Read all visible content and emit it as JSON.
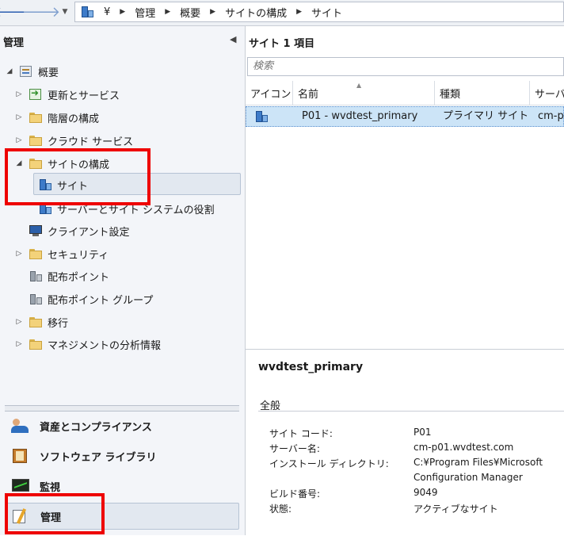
{
  "nav": {
    "back_icon": "back-arrow-icon",
    "forward_icon": "forward-arrow-icon",
    "crumbs": [
      "¥",
      "管理",
      "概要",
      "サイトの構成",
      "サイト"
    ]
  },
  "left_pane": {
    "title": "管理",
    "tree": [
      {
        "label": "概要",
        "icon": "overview-icon",
        "expander": "expanded"
      },
      {
        "label": "更新とサービス",
        "icon": "update-icon",
        "expander": "collapsed"
      },
      {
        "label": "階層の構成",
        "icon": "folder-icon",
        "expander": "collapsed"
      },
      {
        "label": "クラウド サービス",
        "icon": "folder-icon",
        "expander": "collapsed"
      },
      {
        "label": "サイトの構成",
        "icon": "folder-icon",
        "expander": "expanded"
      },
      {
        "label": "サイト",
        "icon": "site-server-icon",
        "selected": true
      },
      {
        "label": "サーバーとサイト システムの役割",
        "icon": "site-server-icon"
      },
      {
        "label": "クライアント設定",
        "icon": "monitor-icon"
      },
      {
        "label": "セキュリティ",
        "icon": "folder-icon",
        "expander": "collapsed"
      },
      {
        "label": "配布ポイント",
        "icon": "distribution-point-icon"
      },
      {
        "label": "配布ポイント グループ",
        "icon": "distribution-point-icon"
      },
      {
        "label": "移行",
        "icon": "folder-icon",
        "expander": "collapsed"
      },
      {
        "label": "マネジメントの分析情報",
        "icon": "folder-icon",
        "expander": "collapsed"
      }
    ],
    "workspaces": [
      {
        "label": "資産とコンプライアンス",
        "icon": "assets-icon"
      },
      {
        "label": "ソフトウェア ライブラリ",
        "icon": "software-library-icon"
      },
      {
        "label": "監視",
        "icon": "monitoring-icon"
      },
      {
        "label": "管理",
        "icon": "administration-icon",
        "selected": true
      }
    ]
  },
  "list": {
    "title": "サイト 1 項目",
    "search_placeholder": "検索",
    "columns": [
      "アイコン",
      "名前",
      "種類",
      "サーバー"
    ],
    "rows": [
      {
        "icon": "site-server-icon",
        "name": "P01 - wvdtest_primary",
        "type": "プライマリ サイト",
        "server": "cm-p"
      }
    ]
  },
  "details": {
    "title": "wvdtest_primary",
    "section": "全般",
    "properties": [
      {
        "label": "サイト コード:",
        "value": "P01"
      },
      {
        "label": "サーバー名:",
        "value": "cm-p01.wvdtest.com"
      },
      {
        "label": "インストール ディレクトリ:",
        "value": "C:¥Program Files¥Microsoft",
        "value2": "Configuration Manager"
      },
      {
        "label": "ビルド番号:",
        "value": "9049"
      },
      {
        "label": "状態:",
        "value": "アクティブなサイト"
      }
    ]
  },
  "colors": {
    "highlight": "#ee0000",
    "selection": "#cce4f7"
  }
}
